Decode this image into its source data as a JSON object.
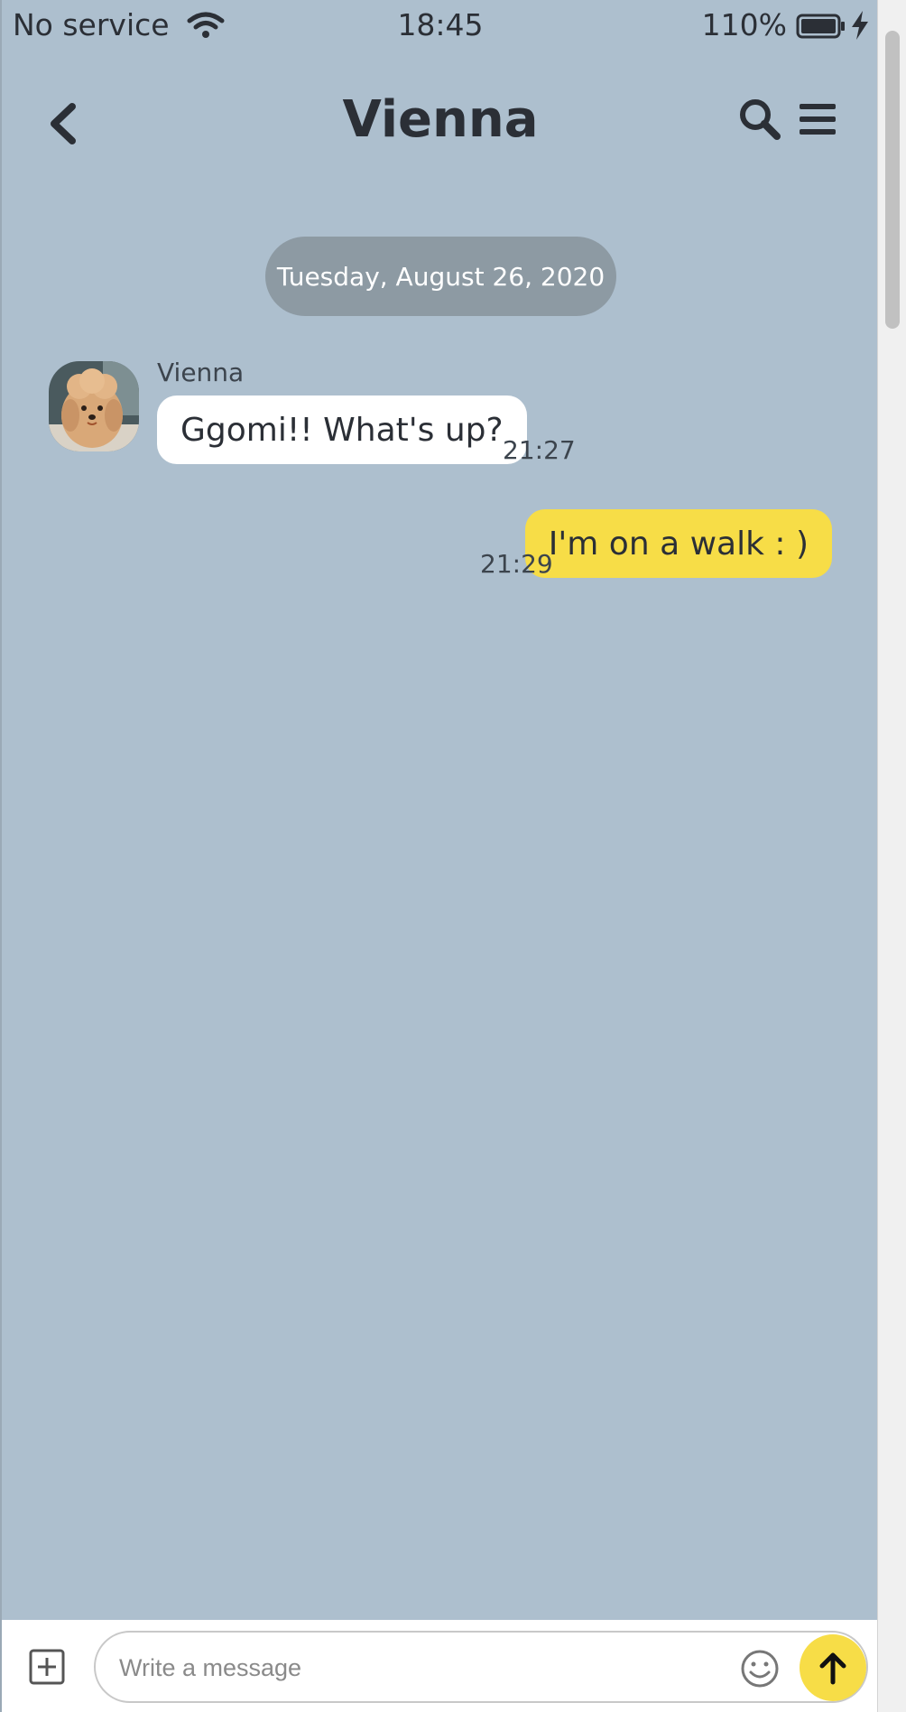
{
  "status_bar": {
    "carrier": "No service",
    "time": "18:45",
    "battery": "110%"
  },
  "header": {
    "title": "Vienna",
    "icons": [
      "back-chevron",
      "search",
      "menu"
    ]
  },
  "date_separator": "Tuesday, August 26, 2020",
  "messages": [
    {
      "direction": "received",
      "sender": "Vienna",
      "text": "Ggomi!! What's up?",
      "time": "21:27"
    },
    {
      "direction": "sent",
      "text": "I'm on a walk : )",
      "time": "21:29"
    }
  ],
  "input": {
    "placeholder": "Write a message",
    "value": ""
  },
  "colors": {
    "background": "#adbfce",
    "sent_bubble": "#f7dd47",
    "received_bubble": "#ffffff",
    "date_pill": "#8d9aa3",
    "send_button": "#f7dd47"
  }
}
